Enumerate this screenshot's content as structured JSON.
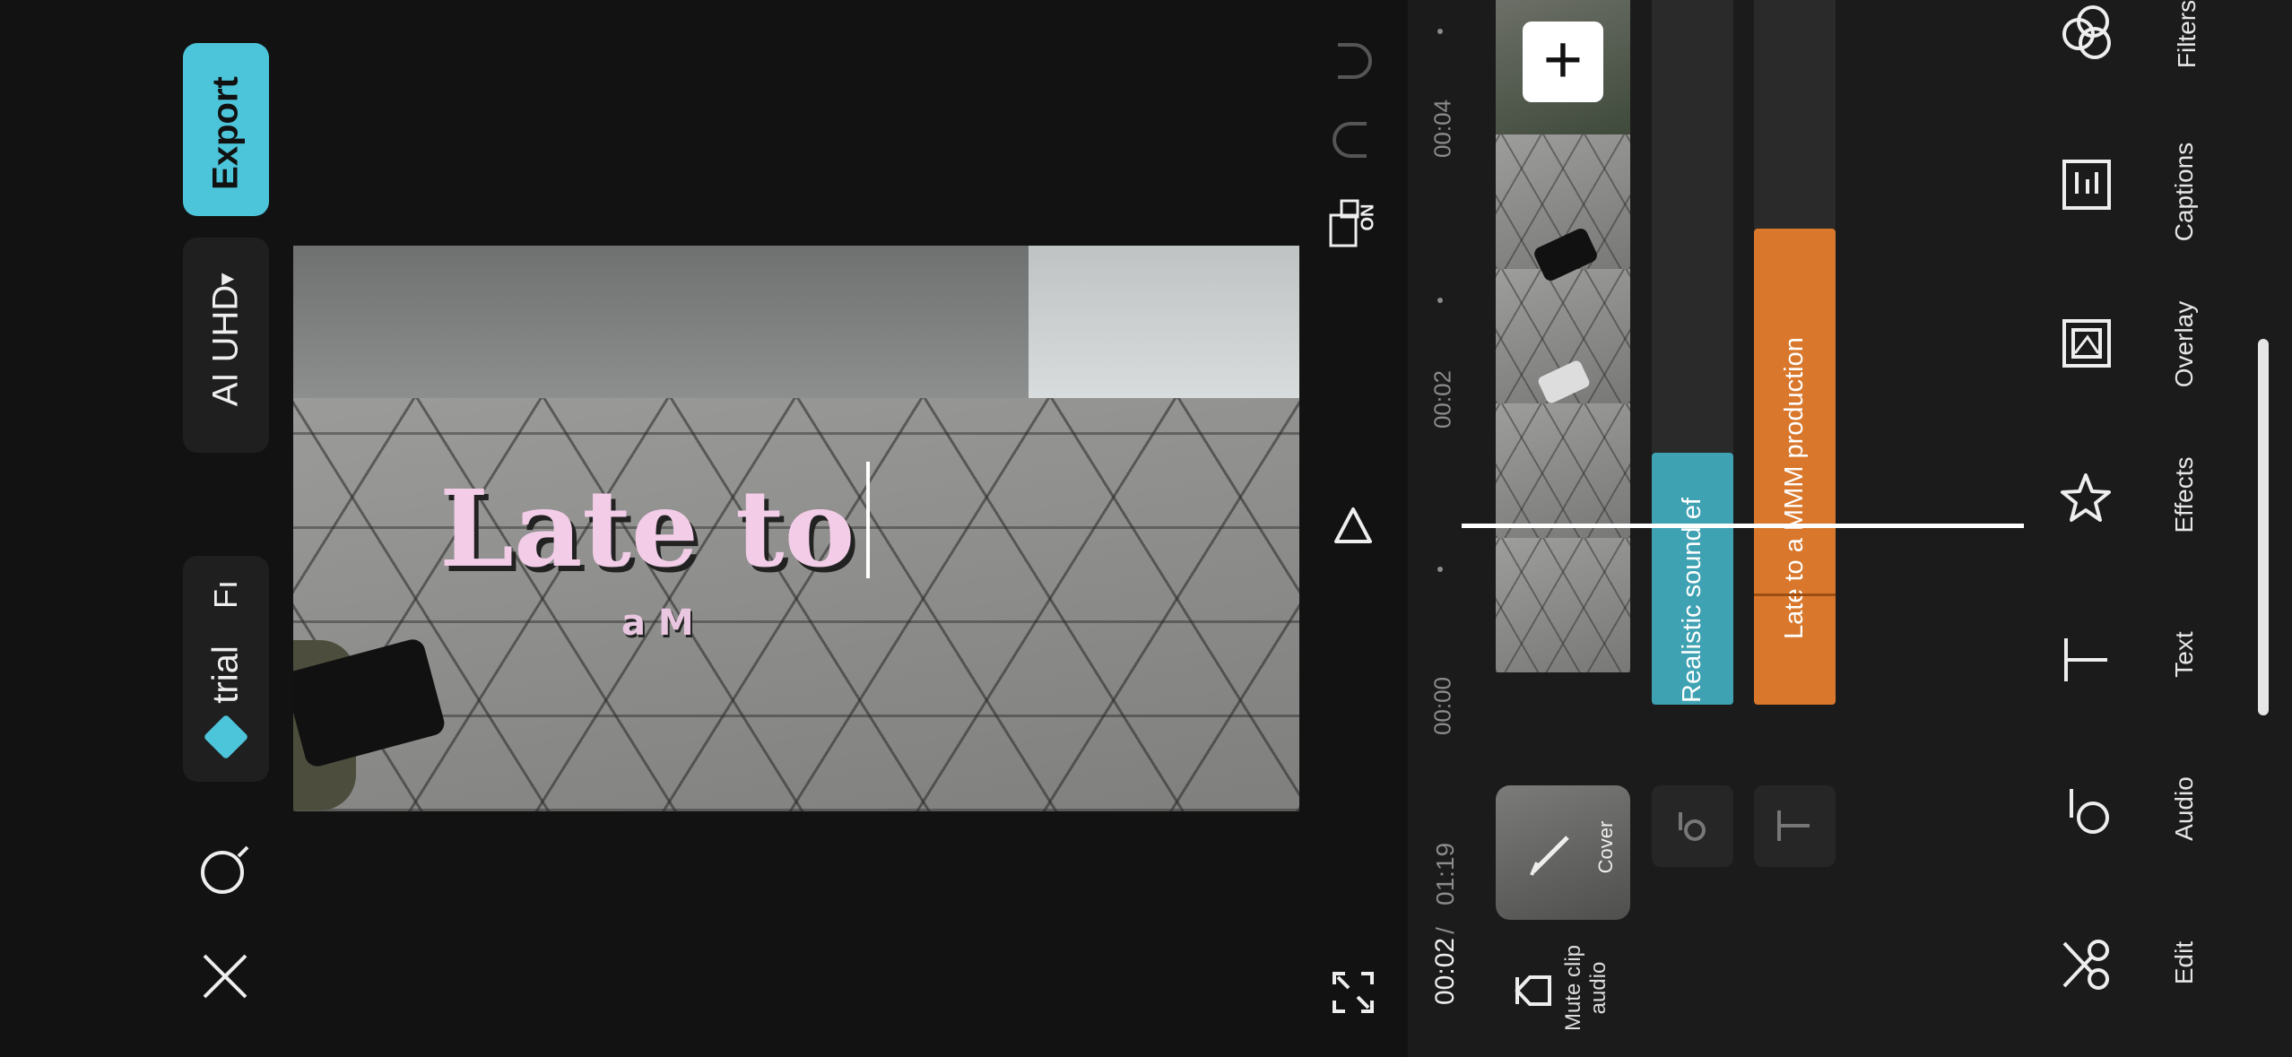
{
  "left_bar": {
    "export_label": "Export",
    "quality_label": "AI UHD",
    "quality_caret": "▾",
    "trial_label": "trial",
    "trial_suffix": "Fı"
  },
  "preview": {
    "main_text": "Late to",
    "sub_text": "a M"
  },
  "timeline": {
    "current_time": "00:02",
    "separator": "/",
    "total_time": "01:19",
    "ticks": [
      "00:00",
      "00:02",
      "00:04"
    ],
    "cover_label": "Cover",
    "mute_label_1": "Mute clip",
    "mute_label_2": "audio",
    "tracks": {
      "sound_label": "Realistic sound ef",
      "text_label": "Late to   a MMM production"
    },
    "add_symbol": "+",
    "split_on": "ON"
  },
  "toolbar": {
    "items": [
      {
        "label": "Filters",
        "icon": "filters-icon"
      },
      {
        "label": "Captions",
        "icon": "captions-icon"
      },
      {
        "label": "Overlay",
        "icon": "overlay-icon"
      },
      {
        "label": "Effects",
        "icon": "effects-icon"
      },
      {
        "label": "Text",
        "icon": "text-icon"
      },
      {
        "label": "Audio",
        "icon": "audio-icon"
      },
      {
        "label": "Edit",
        "icon": "scissors-icon"
      }
    ]
  },
  "colors": {
    "accent": "#4cc4d9",
    "sound_track": "#3fa2b3",
    "text_track": "#d9782c",
    "title_pink": "#f3cde8"
  }
}
